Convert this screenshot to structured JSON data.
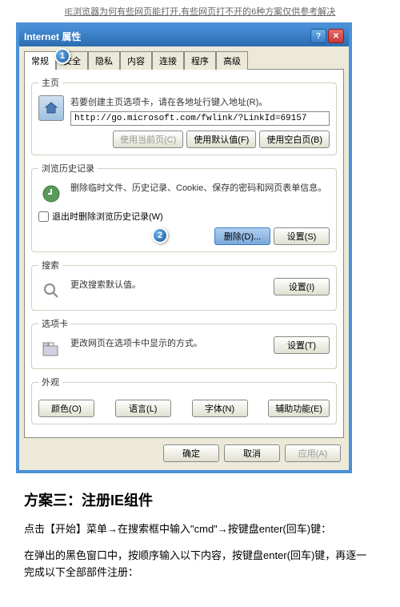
{
  "header": {
    "link": "IE浏览器为何有些网页能打开,有些网页打不开的6种方案仅供参考解决"
  },
  "dialog": {
    "title": "Internet 属性",
    "tabs": [
      "常规",
      "安全",
      "隐私",
      "内容",
      "连接",
      "程序",
      "高级"
    ],
    "badges": {
      "one": "1",
      "two": "2"
    },
    "homepage": {
      "legend": "主页",
      "desc": "若要创建主页选项卡，请在各地址行键入地址(R)。",
      "url": "http://go.microsoft.com/fwlink/?LinkId=69157",
      "btn_current": "使用当前页(C)",
      "btn_default": "使用默认值(F)",
      "btn_blank": "使用空白页(B)"
    },
    "history": {
      "legend": "浏览历史记录",
      "desc": "删除临时文件、历史记录、Cookie、保存的密码和网页表单信息。",
      "checkbox": "退出时删除浏览历史记录(W)",
      "btn_delete": "删除(D)...",
      "btn_settings": "设置(S)"
    },
    "search": {
      "legend": "搜索",
      "desc": "更改搜索默认值。",
      "btn_settings": "设置(I)"
    },
    "tabsSection": {
      "legend": "选项卡",
      "desc": "更改网页在选项卡中显示的方式。",
      "btn_settings": "设置(T)"
    },
    "appearance": {
      "legend": "外观",
      "btn_colors": "颜色(O)",
      "btn_lang": "语言(L)",
      "btn_fonts": "字体(N)",
      "btn_access": "辅助功能(E)"
    },
    "bottom": {
      "ok": "确定",
      "cancel": "取消",
      "apply": "应用(A)"
    }
  },
  "article": {
    "heading": "方案三：注册IE组件",
    "p1": "点击【开始】菜单→在搜索框中输入\"cmd\"→按键盘enter(回车)键：",
    "p2": "在弹出的黑色窗口中，按顺序输入以下内容，按键盘enter(回车)键，再逐一完成以下全部部件注册："
  }
}
